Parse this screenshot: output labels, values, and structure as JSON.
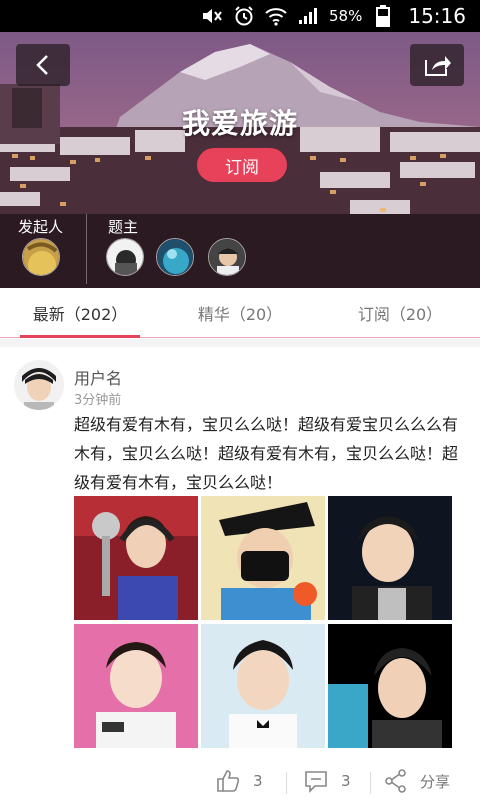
{
  "status_bar": {
    "icons": [
      "mute-icon",
      "alarm-icon",
      "wifi-icon",
      "signal-icon",
      "battery-icon"
    ],
    "battery": "58%",
    "time": "15:16"
  },
  "header": {
    "title": "我爱旅游",
    "subscribe_label": "订阅",
    "founder_label": "发起人",
    "host_label": "题主",
    "back_icon": "back-arrow-icon",
    "share_icon": "share-icon"
  },
  "tabs": [
    {
      "label": "最新（202）",
      "active": true
    },
    {
      "label": "精华（20）",
      "active": false
    },
    {
      "label": "订阅（20）",
      "active": false
    }
  ],
  "post": {
    "username": "用户名",
    "time": "3分钟前",
    "text": "超级有爱有木有，宝贝么么哒！超级有爱宝贝么么么有木有，宝贝么么哒！超级有爱有木有，宝贝么么哒！超级有爱有木有，宝贝么么哒！"
  },
  "actions": {
    "like_count": "3",
    "comment_count": "3",
    "share_label": "分享"
  },
  "colors": {
    "accent": "#e8415a",
    "tab_underline": "#f2a8bb"
  }
}
